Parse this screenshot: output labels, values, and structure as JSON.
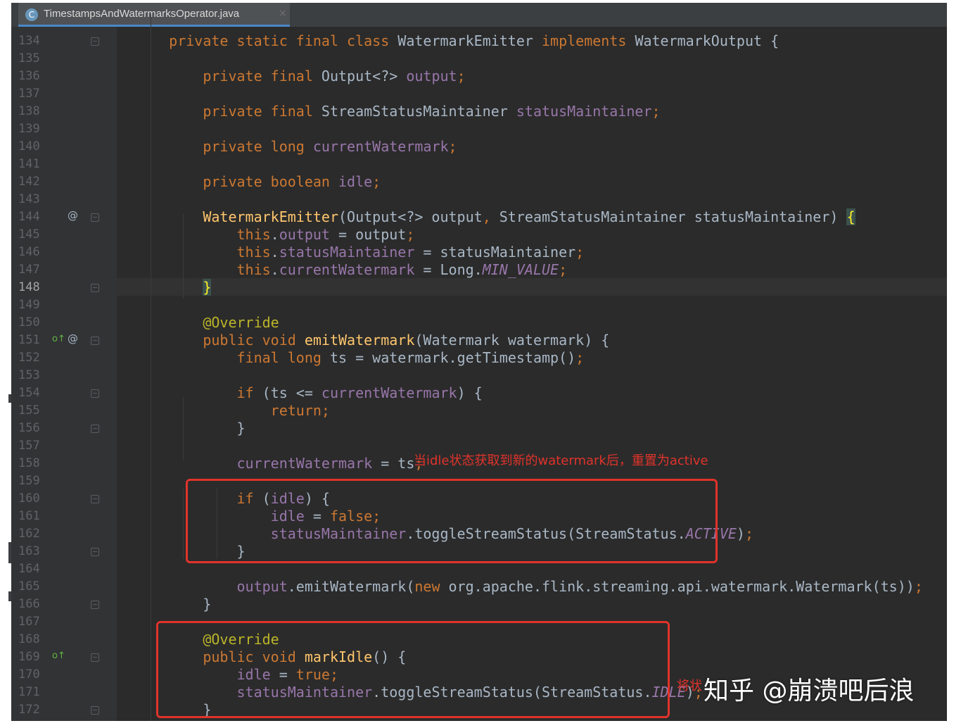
{
  "tab": {
    "filename": "TimestampsAndWatermarksOperator.java",
    "icon": "class-file-icon",
    "close": "×"
  },
  "gutter": {
    "at_symbol": "@",
    "override_symbol": "o↑"
  },
  "lines": [
    {
      "num": "134",
      "code": [
        [
          "    ",
          ""
        ],
        [
          "private static final class ",
          "kw"
        ],
        [
          "WatermarkEmitter ",
          ""
        ],
        [
          "implements ",
          "kw"
        ],
        [
          "WatermarkOutput {",
          ""
        ]
      ]
    },
    {
      "num": "135",
      "code": []
    },
    {
      "num": "136",
      "code": [
        [
          "        ",
          ""
        ],
        [
          "private final ",
          "kw"
        ],
        [
          "Output<?> ",
          ""
        ],
        [
          "output",
          "fld"
        ],
        [
          ";",
          "kw"
        ]
      ]
    },
    {
      "num": "137",
      "code": []
    },
    {
      "num": "138",
      "code": [
        [
          "        ",
          ""
        ],
        [
          "private final ",
          "kw"
        ],
        [
          "StreamStatusMaintainer ",
          ""
        ],
        [
          "statusMaintainer",
          "fld"
        ],
        [
          ";",
          "kw"
        ]
      ]
    },
    {
      "num": "139",
      "code": []
    },
    {
      "num": "140",
      "code": [
        [
          "        ",
          ""
        ],
        [
          "private long ",
          "kw"
        ],
        [
          "currentWatermark",
          "fld"
        ],
        [
          ";",
          "kw"
        ]
      ]
    },
    {
      "num": "141",
      "code": []
    },
    {
      "num": "142",
      "code": [
        [
          "        ",
          ""
        ],
        [
          "private boolean ",
          "kw"
        ],
        [
          "idle",
          "fld"
        ],
        [
          ";",
          "kw"
        ]
      ]
    },
    {
      "num": "143",
      "code": []
    },
    {
      "num": "144",
      "code": [
        [
          "        ",
          ""
        ],
        [
          "WatermarkEmitter",
          "mth"
        ],
        [
          "(Output<?> output",
          ""
        ],
        [
          ", ",
          "kw"
        ],
        [
          "StreamStatusMaintainer statusMaintainer) ",
          ""
        ],
        [
          "{",
          "brm"
        ]
      ]
    },
    {
      "num": "145",
      "code": [
        [
          "            ",
          ""
        ],
        [
          "this",
          "kw"
        ],
        [
          ".",
          ""
        ],
        [
          "output",
          "fld"
        ],
        [
          " = output",
          ""
        ],
        [
          ";",
          "kw"
        ]
      ]
    },
    {
      "num": "146",
      "code": [
        [
          "            ",
          ""
        ],
        [
          "this",
          "kw"
        ],
        [
          ".",
          ""
        ],
        [
          "statusMaintainer",
          "fld"
        ],
        [
          " = statusMaintainer",
          ""
        ],
        [
          ";",
          "kw"
        ]
      ]
    },
    {
      "num": "147",
      "code": [
        [
          "            ",
          ""
        ],
        [
          "this",
          "kw"
        ],
        [
          ".",
          ""
        ],
        [
          "currentWatermark",
          "fld"
        ],
        [
          " = Long.",
          ""
        ],
        [
          "MIN_VALUE",
          "fld it"
        ],
        [
          ";",
          "kw"
        ]
      ]
    },
    {
      "num": "148",
      "code": [
        [
          "        ",
          ""
        ],
        [
          "}",
          "brm"
        ]
      ]
    },
    {
      "num": "149",
      "code": []
    },
    {
      "num": "150",
      "code": [
        [
          "        ",
          ""
        ],
        [
          "@Override",
          "ann"
        ]
      ]
    },
    {
      "num": "151",
      "code": [
        [
          "        ",
          ""
        ],
        [
          "public void ",
          "kw"
        ],
        [
          "emitWatermark",
          "mth"
        ],
        [
          "(Watermark watermark) {",
          ""
        ]
      ]
    },
    {
      "num": "152",
      "code": [
        [
          "            ",
          ""
        ],
        [
          "final long ",
          "kw"
        ],
        [
          "ts = watermark.getTimestamp()",
          ""
        ],
        [
          ";",
          "kw"
        ]
      ]
    },
    {
      "num": "153",
      "code": []
    },
    {
      "num": "154",
      "code": [
        [
          "            ",
          ""
        ],
        [
          "if ",
          "kw"
        ],
        [
          "(ts <= ",
          ""
        ],
        [
          "currentWatermark",
          "fld"
        ],
        [
          ") {",
          ""
        ]
      ]
    },
    {
      "num": "155",
      "code": [
        [
          "                ",
          ""
        ],
        [
          "return;",
          "kw"
        ]
      ]
    },
    {
      "num": "156",
      "code": [
        [
          "            }",
          ""
        ]
      ]
    },
    {
      "num": "157",
      "code": []
    },
    {
      "num": "158",
      "code": [
        [
          "            ",
          ""
        ],
        [
          "currentWatermark",
          "fld"
        ],
        [
          " = ts",
          ""
        ],
        [
          ";",
          "kw"
        ]
      ]
    },
    {
      "num": "159",
      "code": []
    },
    {
      "num": "160",
      "code": [
        [
          "            ",
          ""
        ],
        [
          "if ",
          "kw"
        ],
        [
          "(",
          ""
        ],
        [
          "idle",
          "fld"
        ],
        [
          ") {",
          ""
        ]
      ]
    },
    {
      "num": "161",
      "code": [
        [
          "                ",
          ""
        ],
        [
          "idle",
          "fld"
        ],
        [
          " = ",
          ""
        ],
        [
          "false;",
          "kw"
        ]
      ]
    },
    {
      "num": "162",
      "code": [
        [
          "                ",
          ""
        ],
        [
          "statusMaintainer",
          "fld"
        ],
        [
          ".toggleStreamStatus(StreamStatus.",
          ""
        ],
        [
          "ACTIVE",
          "fld it"
        ],
        [
          ")",
          ""
        ],
        [
          ";",
          "kw"
        ]
      ]
    },
    {
      "num": "163",
      "code": [
        [
          "            }",
          ""
        ]
      ]
    },
    {
      "num": "164",
      "code": []
    },
    {
      "num": "165",
      "code": [
        [
          "            ",
          ""
        ],
        [
          "output",
          "fld"
        ],
        [
          ".emitWatermark(",
          ""
        ],
        [
          "new ",
          "kw"
        ],
        [
          "org.apache.flink.streaming.api.watermark.Watermark(ts))",
          ""
        ],
        [
          ";",
          "kw"
        ]
      ]
    },
    {
      "num": "166",
      "code": [
        [
          "        }",
          ""
        ]
      ]
    },
    {
      "num": "167",
      "code": []
    },
    {
      "num": "168",
      "code": [
        [
          "        ",
          ""
        ],
        [
          "@Override",
          "ann"
        ]
      ]
    },
    {
      "num": "169",
      "code": [
        [
          "        ",
          ""
        ],
        [
          "public void ",
          "kw"
        ],
        [
          "markIdle",
          "mth"
        ],
        [
          "() {",
          ""
        ]
      ]
    },
    {
      "num": "170",
      "code": [
        [
          "            ",
          ""
        ],
        [
          "idle",
          "fld"
        ],
        [
          " = ",
          ""
        ],
        [
          "true;",
          "kw"
        ]
      ]
    },
    {
      "num": "171",
      "code": [
        [
          "            ",
          ""
        ],
        [
          "statusMaintainer",
          "fld"
        ],
        [
          ".toggleStreamStatus(StreamStatus.",
          ""
        ],
        [
          "IDLE",
          "fld it"
        ],
        [
          ")",
          ""
        ],
        [
          ";",
          "kw"
        ]
      ]
    },
    {
      "num": "172",
      "code": [
        [
          "        }",
          ""
        ]
      ]
    }
  ],
  "annotations": {
    "note_active": "当idle状态获取到新的watermark后，重置为active",
    "note_idle": "将状"
  },
  "watermark": "知乎 @崩溃吧后浪",
  "colors": {
    "keyword": "#cc7832",
    "field": "#9876aa",
    "annotation": "#bbb529",
    "method": "#ffc66d",
    "highlight_box": "#e0332b",
    "background": "#2b2b2b"
  }
}
